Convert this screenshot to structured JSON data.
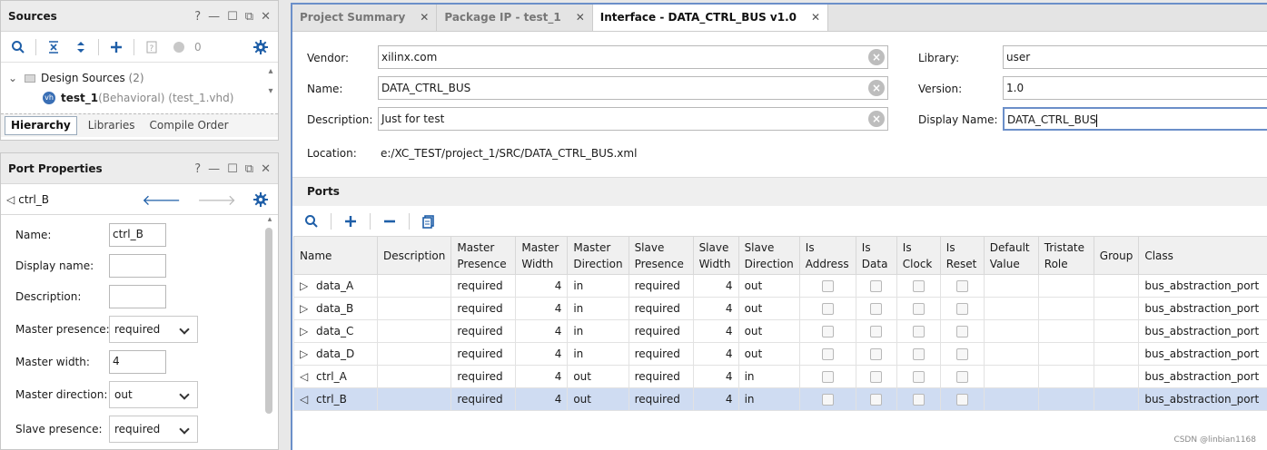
{
  "sources": {
    "title": "Sources",
    "counter": "0",
    "tree": {
      "group_label": "Design Sources",
      "group_count": "(2)",
      "file_name": "test_1",
      "file_detail": "(Behavioral) (test_1.vhd)"
    },
    "tabs": [
      "Hierarchy",
      "Libraries",
      "Compile Order"
    ]
  },
  "port_properties": {
    "title": "Port Properties",
    "selected_port": "ctrl_B",
    "fields": [
      {
        "label": "Name:",
        "value": "ctrl_B",
        "type": "input"
      },
      {
        "label": "Display name:",
        "value": "",
        "type": "input"
      },
      {
        "label": "Description:",
        "value": "",
        "type": "input"
      },
      {
        "label": "Master presence:",
        "value": "required",
        "type": "select"
      },
      {
        "label": "Master width:",
        "value": "4",
        "type": "input"
      },
      {
        "label": "Master direction:",
        "value": "out",
        "type": "select"
      },
      {
        "label": "Slave presence:",
        "value": "required",
        "type": "select"
      }
    ]
  },
  "editor": {
    "tabs": [
      {
        "label": "Project Summary",
        "active": false
      },
      {
        "label": "Package IP - test_1",
        "active": false
      },
      {
        "label": "Interface - DATA_CTRL_BUS v1.0",
        "active": true
      }
    ],
    "vendor_label": "Vendor:",
    "vendor": "xilinx.com",
    "name_label": "Name:",
    "name": "DATA_CTRL_BUS",
    "description_label": "Description:",
    "description": "Just for test",
    "library_label": "Library:",
    "library": "user",
    "version_label": "Version:",
    "version": "1.0",
    "display_name_label": "Display Name:",
    "display_name": "DATA_CTRL_BUS",
    "location_label": "Location:",
    "location": "e:/XC_TEST/project_1/SRC/DATA_CTRL_BUS.xml",
    "ports_title": "Ports"
  },
  "ports_table": {
    "columns": [
      "Name",
      "Description",
      "Master Presence",
      "Master Width",
      "Master Direction",
      "Slave Presence",
      "Slave Width",
      "Slave Direction",
      "Is Address",
      "Is Data",
      "Is Clock",
      "Is Reset",
      "Default Value",
      "Tristate Role",
      "Group",
      "Class"
    ],
    "rows": [
      {
        "dir": "in",
        "name": "data_A",
        "mp": "required",
        "mw": "4",
        "md": "in",
        "sp": "required",
        "sw": "4",
        "sd": "out",
        "cls": "bus_abstraction_port",
        "selected": false
      },
      {
        "dir": "in",
        "name": "data_B",
        "mp": "required",
        "mw": "4",
        "md": "in",
        "sp": "required",
        "sw": "4",
        "sd": "out",
        "cls": "bus_abstraction_port",
        "selected": false
      },
      {
        "dir": "in",
        "name": "data_C",
        "mp": "required",
        "mw": "4",
        "md": "in",
        "sp": "required",
        "sw": "4",
        "sd": "out",
        "cls": "bus_abstraction_port",
        "selected": false
      },
      {
        "dir": "in",
        "name": "data_D",
        "mp": "required",
        "mw": "4",
        "md": "in",
        "sp": "required",
        "sw": "4",
        "sd": "out",
        "cls": "bus_abstraction_port",
        "selected": false
      },
      {
        "dir": "out",
        "name": "ctrl_A",
        "mp": "required",
        "mw": "4",
        "md": "out",
        "sp": "required",
        "sw": "4",
        "sd": "in",
        "cls": "bus_abstraction_port",
        "selected": false
      },
      {
        "dir": "out",
        "name": "ctrl_B",
        "mp": "required",
        "mw": "4",
        "md": "out",
        "sp": "required",
        "sw": "4",
        "sd": "in",
        "cls": "bus_abstraction_port",
        "selected": true
      }
    ]
  },
  "watermark": "CSDN @linbian1168",
  "colors": {
    "accent": "#1f5fa8",
    "selected_row": "#cfdcf2",
    "focus_border": "#6b8fc9"
  }
}
